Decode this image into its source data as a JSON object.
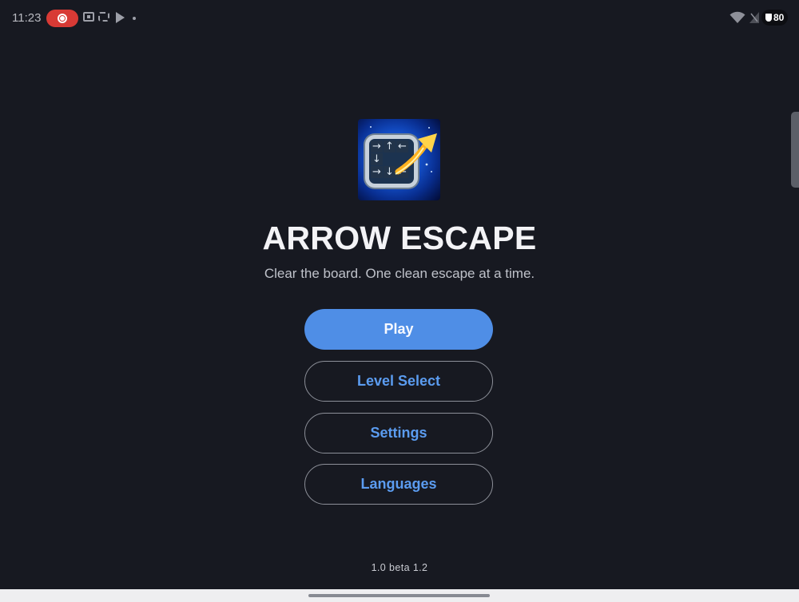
{
  "status_bar": {
    "time": "11:23",
    "battery": "80",
    "icons": [
      "screen-record-icon",
      "cast-icon",
      "screen-record-area-icon",
      "play-store-icon",
      "more-notifications-icon",
      "wifi-icon",
      "signal-icon",
      "battery-shield-icon"
    ]
  },
  "app": {
    "title": "ARROW ESCAPE",
    "tagline": "Clear the board. One clean escape at a time.",
    "logo_icon": "arrow-escape-logo-icon",
    "version": "1.0 beta 1.2"
  },
  "menu": {
    "play": "Play",
    "level_select": "Level Select",
    "settings": "Settings",
    "languages": "Languages"
  },
  "colors": {
    "background": "#171921",
    "primary": "#4f8ee6",
    "outline_text": "#5b9cf0",
    "title": "#f3f3f6",
    "tagline": "#bfc2ca"
  }
}
